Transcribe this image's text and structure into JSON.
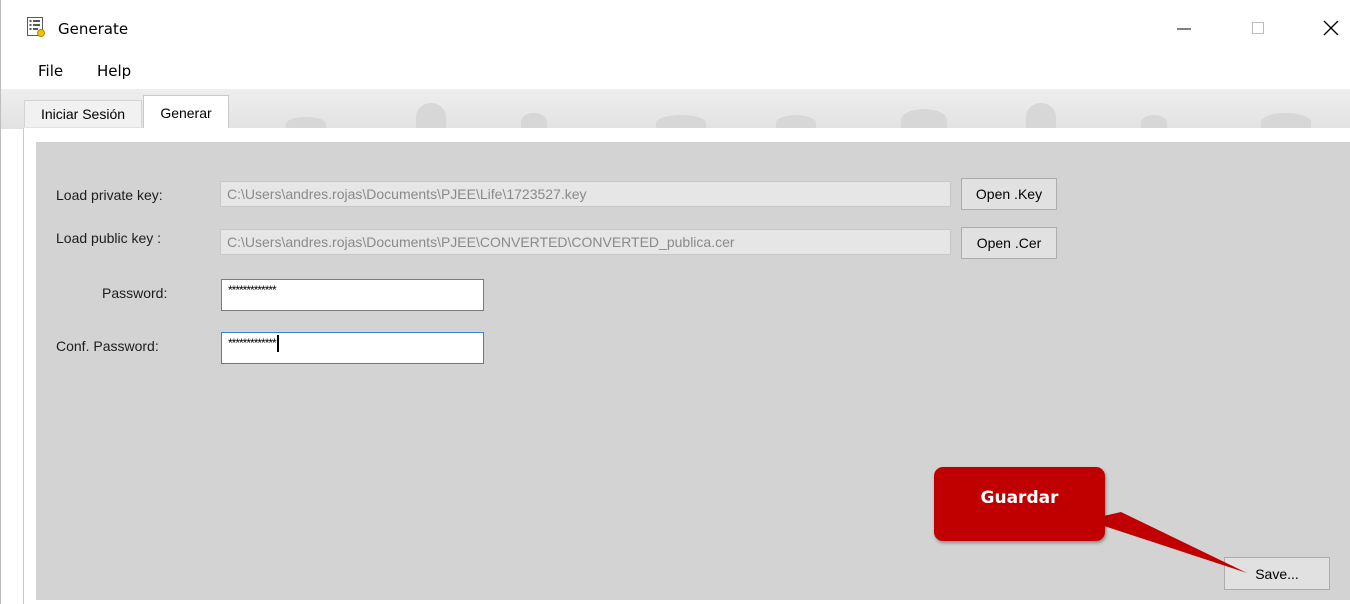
{
  "window": {
    "title": "Generate",
    "icon": "form-icon"
  },
  "menu": {
    "file": "File",
    "help": "Help"
  },
  "tabs": [
    {
      "label": "Iniciar Sesión",
      "selected": false
    },
    {
      "label": "Generar",
      "selected": true
    }
  ],
  "form": {
    "private_key_label": "Load private key:",
    "private_key_value": "C:\\Users\\andres.rojas\\Documents\\PJEE\\Life\\1723527.key",
    "open_key_label": "Open .Key",
    "public_key_label": "Load public key :",
    "public_key_value": "C:\\Users\\andres.rojas\\Documents\\PJEE\\CONVERTED\\CONVERTED_publica.cer",
    "open_cer_label": "Open .Cer",
    "password_label": "Password:",
    "password_value": "*************",
    "conf_password_label": "Conf. Password:",
    "conf_password_value": "*************",
    "save_label": "Save..."
  },
  "callout": {
    "text": "Guardar",
    "color": "#c00000"
  }
}
